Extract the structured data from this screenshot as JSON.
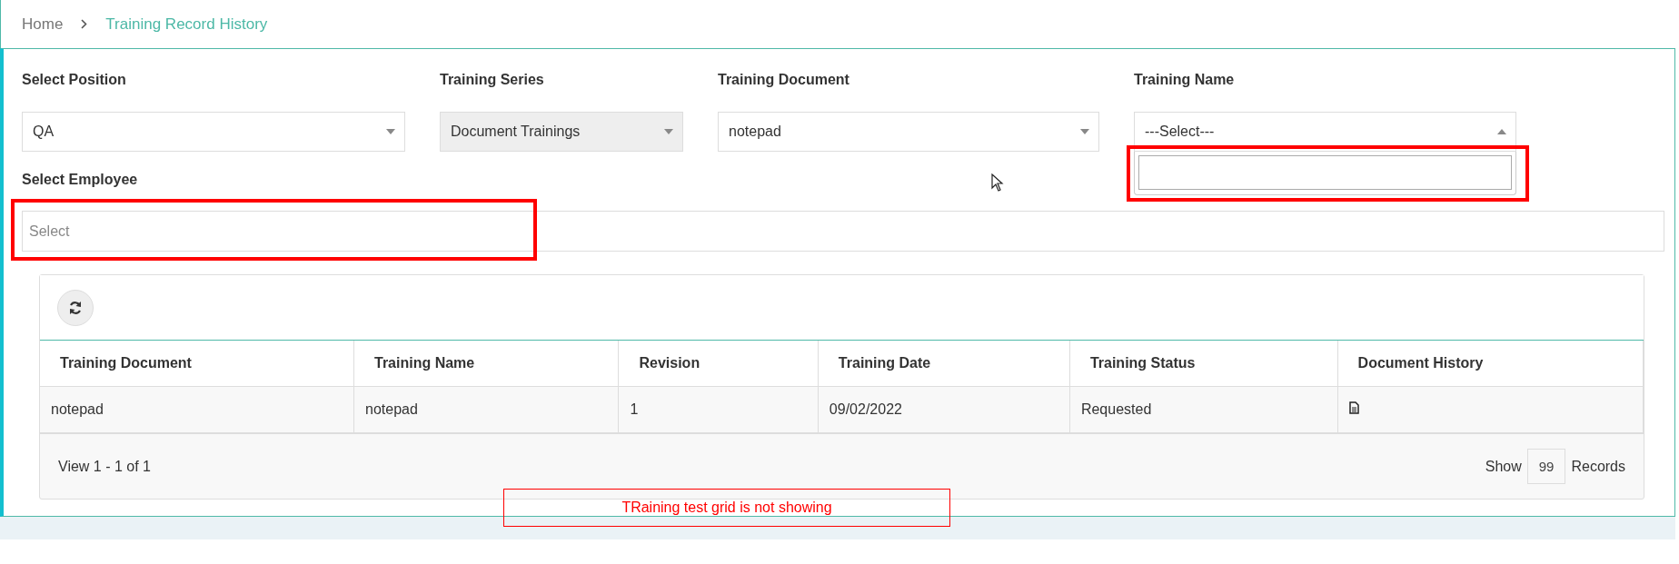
{
  "breadcrumb": [
    {
      "label": "Home",
      "current": false
    },
    {
      "label": "Training Record History",
      "current": true
    }
  ],
  "filters": [
    {
      "label": "Select Position",
      "value": "QA",
      "disabled": false,
      "expanded": false
    },
    {
      "label": "Training Series",
      "value": "Document Trainings",
      "disabled": true,
      "expanded": false
    },
    {
      "label": "Training Document",
      "value": "notepad",
      "disabled": false,
      "expanded": false
    },
    {
      "label": "Training Name",
      "value": "---Select---",
      "disabled": false,
      "expanded": true
    }
  ],
  "employee": {
    "label": "Select Employee",
    "placeholder": "Select"
  },
  "grid": {
    "columns": [
      "Training Document",
      "Training Name",
      "Revision",
      "Training Date",
      "Training Status",
      "Document History"
    ],
    "rows": [
      {
        "cells": [
          "notepad",
          "notepad",
          "1",
          "09/02/2022",
          "Requested"
        ]
      }
    ],
    "pager": {
      "view": "View 1 - 1 of 1",
      "show": "Show",
      "page_size": "99",
      "records": "Records"
    }
  },
  "annotation": {
    "note": "TRaining test grid is not showing"
  }
}
